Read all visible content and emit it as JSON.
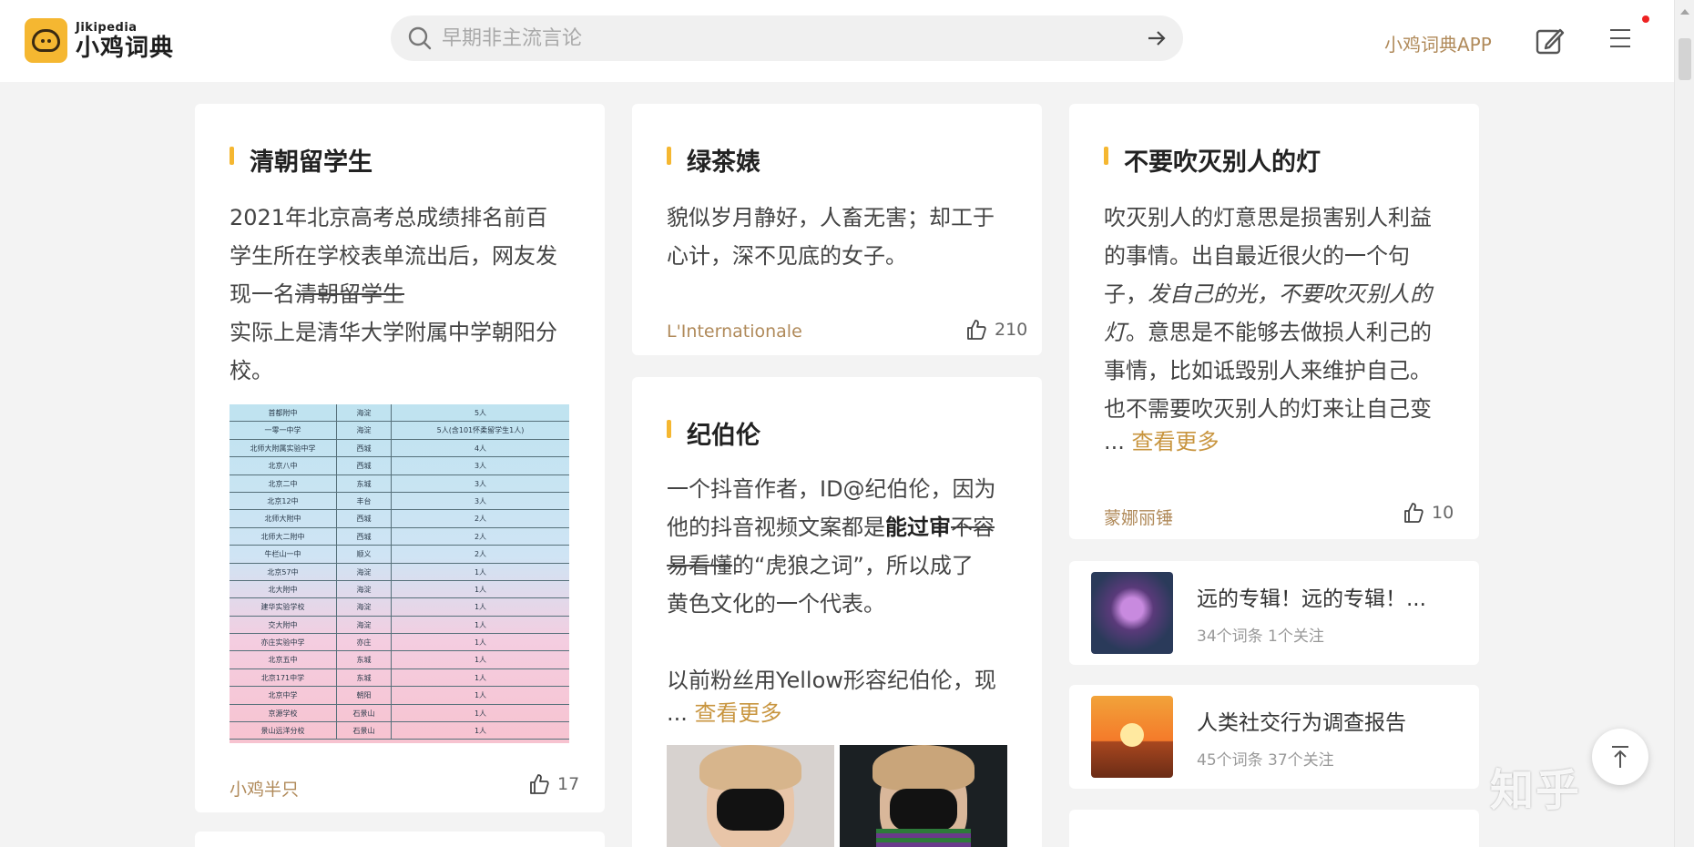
{
  "header": {
    "logo_en": "Jikipedia",
    "logo_cn": "小鸡词典",
    "search_placeholder": "早期非主流言论",
    "app_link": "小鸡词典APP"
  },
  "colors": {
    "brand": "#f5b731",
    "author": "#b08a5a",
    "more": "#c8953f",
    "notification": "#ee2222"
  },
  "icons": [
    "search-icon",
    "arrow-right-icon",
    "edit-icon",
    "menu-icon",
    "thumb-up-icon",
    "back-to-top-icon"
  ],
  "cards": [
    {
      "title": "清朝留学生",
      "body_line1": " 2021年北京高考总成绩排名前百",
      "body_line2": "学生所在学校表单流出后，网友发",
      "body_line3_prefix": "现一名",
      "body_line3_strike": "清朝留学生",
      "body_line4": "实际上是清华大学附属中学朝阳分",
      "body_line5": "校。",
      "author": "小鸡半只",
      "likes": "17",
      "table_rows": [
        [
          "首都附中",
          "海淀",
          "5人"
        ],
        [
          "一零一中学",
          "海淀",
          "5人(含101怀柔留学生1人)"
        ],
        [
          "北师大附属实验中学",
          "西城",
          "4人"
        ],
        [
          "北京八中",
          "西城",
          "3人"
        ],
        [
          "北京二中",
          "东城",
          "3人"
        ],
        [
          "北京12中",
          "丰台",
          "3人"
        ],
        [
          "北师大附中",
          "西城",
          "2人"
        ],
        [
          "北师大二附中",
          "西城",
          "2人"
        ],
        [
          "牛栏山一中",
          "顺义",
          "2人"
        ],
        [
          "北京57中",
          "海淀",
          "1人"
        ],
        [
          "北大附中",
          "海淀",
          "1人"
        ],
        [
          "建华实验学校",
          "海淀",
          "1人"
        ],
        [
          "交大附中",
          "海淀",
          "1人"
        ],
        [
          "亦庄实验中学",
          "亦庄",
          "1人"
        ],
        [
          "北京五中",
          "东城",
          "1人"
        ],
        [
          "北京171中学",
          "东城",
          "1人"
        ],
        [
          "北京中学",
          "朝阳",
          "1人"
        ],
        [
          "京源学校",
          "石景山",
          "1人"
        ],
        [
          "景山远洋分校",
          "石景山",
          "1人"
        ]
      ]
    },
    {
      "title": "绿茶婊",
      "body_line1": "貌似岁月静好，人畜无害；却工于",
      "body_line2": "心计，深不见底的女子。",
      "author": "L'Internationale",
      "likes": "210"
    },
    {
      "title": "纪伯伦",
      "body_line1": "一个抖音作者，ID@纪伯伦，因为",
      "body_line2_prefix": "他的抖音视频文案都是",
      "body_line2_bold": "能过审",
      "body_line2_strike": "不容",
      "body_line3_strike": "易看懂",
      "body_line3_suffix": "的“虎狼之词”，所以成了",
      "body_line4": "黄色文化的一个代表。",
      "body_line5": "以前粉丝用Yellow形容纪伯伦，现",
      "ellipsis": "...",
      "more": "查看更多"
    },
    {
      "title": "不要吹灭别人的灯",
      "body_line1": "吹灭别人的灯意思是损害别人利益",
      "body_line2": "的事情。出自最近很火的一个句",
      "body_line3_prefix": "子，",
      "body_line3_italic": "发自己的光，不要吹灭别人的",
      "body_line4_italic": "灯",
      "body_line4_suffix": "。意思是不能够去做损人利己的",
      "body_line5": "事情，比如诋毁别人来维护自己。",
      "body_line6": "也不需要吹灭别人的灯来让自己变",
      "ellipsis": "...",
      "more": "查看更多",
      "author": "蒙娜丽锤",
      "likes": "10"
    }
  ],
  "collections": [
    {
      "title": "远的专辑！远的专辑！...",
      "meta": "34个词条  1个关注"
    },
    {
      "title": "人类社交行为调查报告",
      "meta": "45个词条  37个关注"
    }
  ],
  "watermark": "知乎"
}
